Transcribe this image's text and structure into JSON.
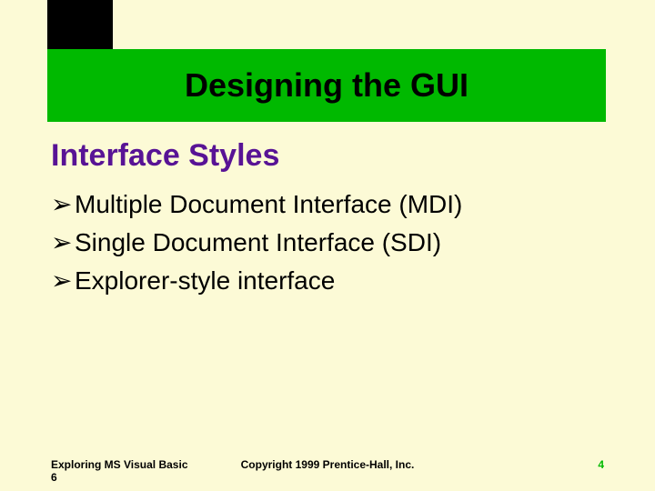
{
  "title": "Designing the GUI",
  "subtitle": "Interface Styles",
  "bullet_marker": "➢",
  "bullets": [
    "Multiple Document Interface (MDI)",
    "Single Document Interface (SDI)",
    "Explorer-style interface"
  ],
  "footer": {
    "left": "Exploring MS Visual Basic 6",
    "center": "Copyright 1999 Prentice-Hall, Inc.",
    "right": "4"
  },
  "colors": {
    "background": "#fcfad6",
    "title_band": "#00b900",
    "subtitle": "#581395",
    "page_number": "#00b900"
  }
}
